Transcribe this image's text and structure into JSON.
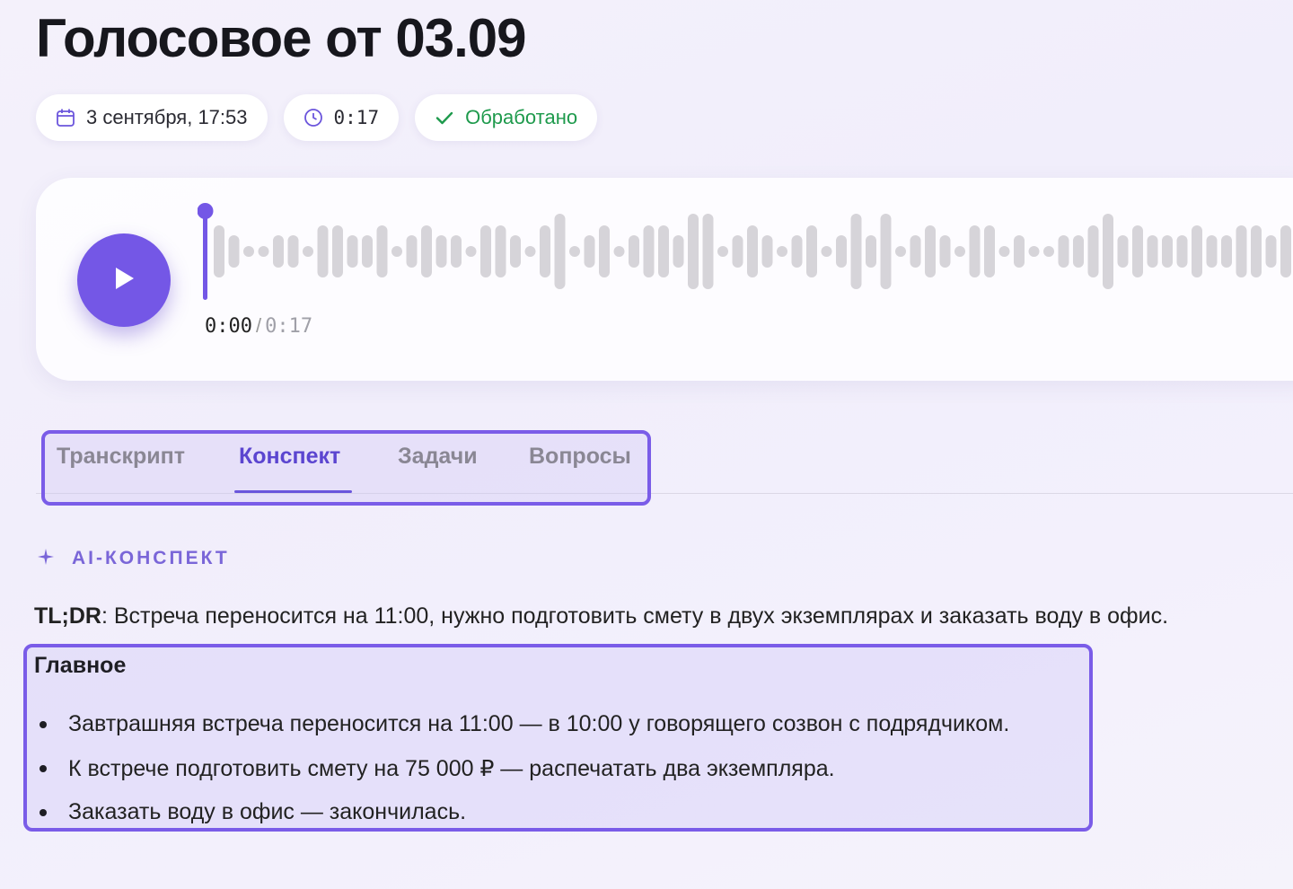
{
  "title": "Голосовое от 03.09",
  "chips": {
    "date": "3 сентября, 17:53",
    "duration": "0:17",
    "status": "Обработано"
  },
  "icons": {
    "date": "calendar-icon",
    "duration": "clock-icon",
    "status": "check-icon",
    "play": "play-icon",
    "ai": "sparkle-icon"
  },
  "player": {
    "current_time": "0:00",
    "separator": "/",
    "total_time": "0:17",
    "progress": 0
  },
  "tabs": [
    {
      "label": "Транскрипт",
      "active": false
    },
    {
      "label": "Конспект",
      "active": true
    },
    {
      "label": "Задачи",
      "active": false
    },
    {
      "label": "Вопросы",
      "active": false
    }
  ],
  "summary": {
    "section_label": "AI-КОНСПЕКТ",
    "tldr_label": "TL;DR",
    "tldr_text": ": Встреча переносится на 11:00, нужно подготовить смету в двух экземплярах и заказать воду в офис.",
    "main_title": "Главное",
    "main_items": [
      "Завтрашняя встреча переносится на 11:00 — в 10:00 у говорящего созвон с подрядчиком.",
      "К встрече подготовить смету на 75 000 ₽ — распечатать два экземпляра.",
      "Заказать воду в офис — закончилась."
    ]
  },
  "colors": {
    "accent": "#7457e6",
    "success": "#1e9a4c",
    "highlight_border": "#7a5ce8"
  }
}
